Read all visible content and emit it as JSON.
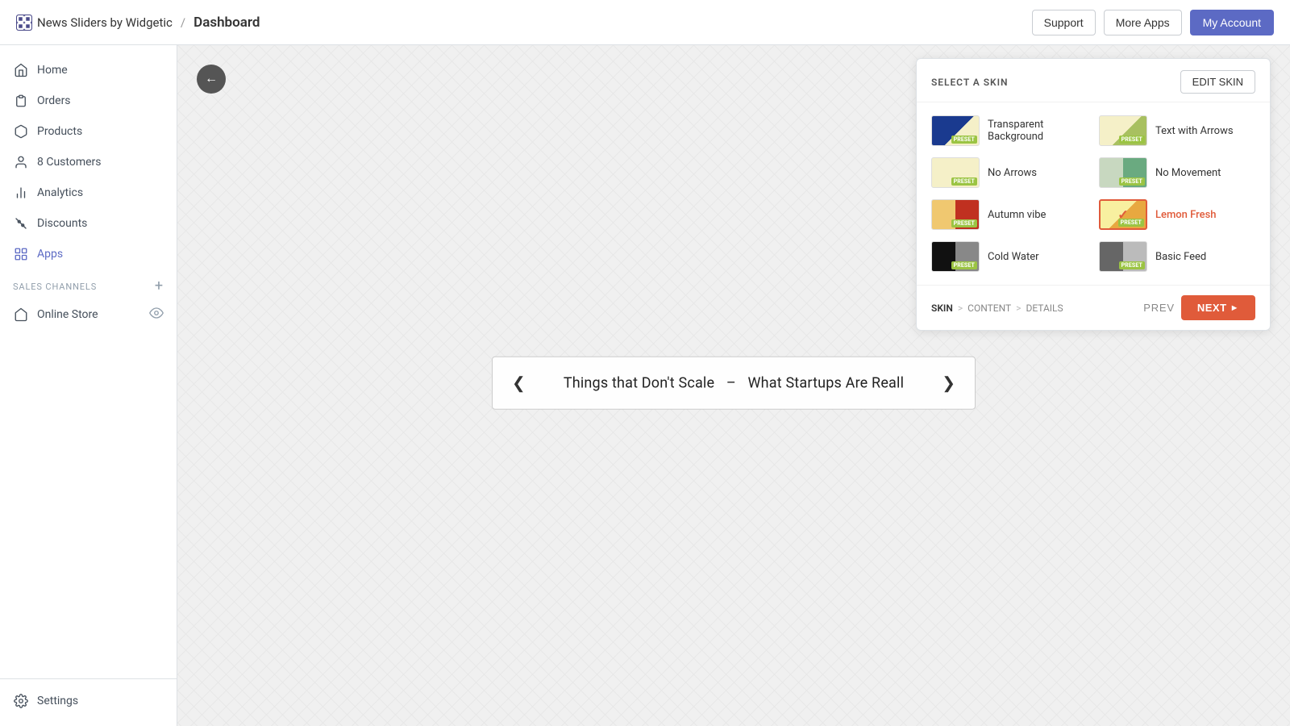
{
  "topbar": {
    "app_name": "News Sliders by Widgetic",
    "separator": "/",
    "page_title": "Dashboard",
    "support_label": "Support",
    "more_apps_label": "More Apps",
    "account_label": "My Account"
  },
  "sidebar": {
    "items": [
      {
        "id": "home",
        "label": "Home",
        "icon": "home-icon"
      },
      {
        "id": "orders",
        "label": "Orders",
        "icon": "orders-icon"
      },
      {
        "id": "products",
        "label": "Products",
        "icon": "products-icon"
      },
      {
        "id": "customers",
        "label": "8 Customers",
        "icon": "customers-icon"
      },
      {
        "id": "analytics",
        "label": "Analytics",
        "icon": "analytics-icon"
      },
      {
        "id": "discounts",
        "label": "Discounts",
        "icon": "discounts-icon"
      },
      {
        "id": "apps",
        "label": "Apps",
        "icon": "apps-icon",
        "active": true
      }
    ],
    "sales_channels_label": "SALES CHANNELS",
    "online_store_label": "Online Store",
    "settings_label": "Settings"
  },
  "slider_preview": {
    "text1": "Things that Don't Scale",
    "dash": "–",
    "text2": "What Startups Are Reall"
  },
  "skin_panel": {
    "header": "SELECT A SKIN",
    "edit_btn": "EDIT SKIN",
    "skins": [
      {
        "id": "transparent",
        "name": "Transparent Background",
        "class": "skin-transparent",
        "selected": false
      },
      {
        "id": "text-arrows",
        "name": "Text with Arrows",
        "class": "skin-text-arrows",
        "selected": false
      },
      {
        "id": "no-arrows",
        "name": "No Arrows",
        "class": "skin-no-arrows",
        "selected": false
      },
      {
        "id": "no-movement",
        "name": "No Movement",
        "class": "skin-no-movement",
        "selected": false
      },
      {
        "id": "autumn",
        "name": "Autumn vibe",
        "class": "skin-autumn",
        "selected": false
      },
      {
        "id": "lemon",
        "name": "Lemon Fresh",
        "class": "skin-lemon",
        "selected": true
      },
      {
        "id": "cold",
        "name": "Cold Water",
        "class": "skin-cold",
        "selected": false
      },
      {
        "id": "basic",
        "name": "Basic Feed",
        "class": "skin-basic",
        "selected": false
      }
    ],
    "preset_label": "PRESET",
    "breadcrumb": {
      "skin": "SKIN",
      "content": "CONTENT",
      "details": "DETAILS"
    },
    "prev_label": "PREV",
    "next_label": "NEXT"
  }
}
